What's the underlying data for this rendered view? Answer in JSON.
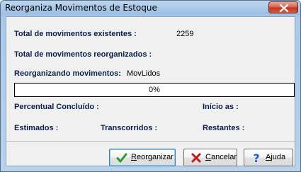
{
  "window": {
    "title": "Reorganiza Movimentos de Estoque"
  },
  "stats": {
    "total_existentes_label": "Total de movimentos existentes :",
    "total_existentes_value": "2259",
    "total_reorganizados_label": "Total de movimentos reorganizados :",
    "total_reorganizados_value": "",
    "reorganizando_label": "Reorganizando movimentos:",
    "reorganizando_value": "MovLidos"
  },
  "progress": {
    "text": "0%",
    "fraction": 0
  },
  "timing": {
    "percentual_label": "Percentual Concluído :",
    "inicio_label": "Início as :",
    "estimados_label": "Estimados :",
    "transcorridos_label": "Transcorridos :",
    "restantes_label": "Restantes :"
  },
  "buttons": {
    "reorganizar": {
      "mnemonic": "R",
      "rest": "eorganizar",
      "icon": "green-check-icon"
    },
    "cancelar": {
      "mnemonic": "C",
      "rest": "ancelar",
      "icon": "red-x-icon"
    },
    "ajuda": {
      "mnemonic": "A",
      "rest": "juda",
      "icon": "help-question-icon"
    }
  },
  "colors": {
    "label_text": "#0b1f4b",
    "progress_fill": "#3a6fd0",
    "check_green": "#2e9a2a",
    "cancel_red": "#c01818",
    "help_blue": "#1f5fc0"
  }
}
